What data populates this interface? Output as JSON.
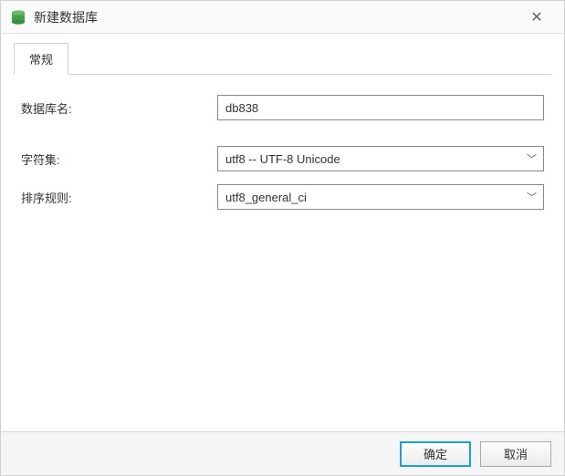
{
  "window": {
    "title": "新建数据库"
  },
  "tabs": {
    "general": "常规"
  },
  "form": {
    "db_name_label": "数据库名:",
    "db_name_value": "db838",
    "charset_label": "字符集:",
    "charset_value": "utf8 -- UTF-8 Unicode",
    "collation_label": "排序规则:",
    "collation_value": "utf8_general_ci"
  },
  "buttons": {
    "ok": "确定",
    "cancel": "取消"
  },
  "icons": {
    "close": "✕",
    "chevron": "﹀"
  }
}
